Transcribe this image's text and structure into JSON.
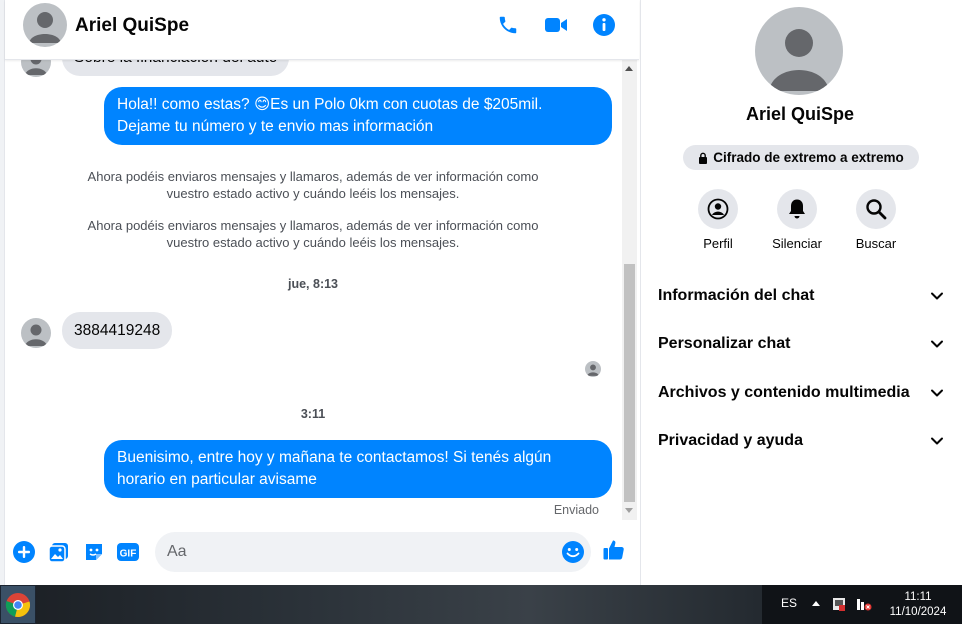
{
  "contact": {
    "name": "Ariel QuiSpe"
  },
  "header": {
    "icons": [
      "phone-icon",
      "video-icon",
      "info-icon"
    ]
  },
  "messages": {
    "partial_top": "Sobre la financiación del auto",
    "outgoing_1_line1": "Hola!! como estas? 😊Es un Polo 0km con cuotas de $205mil.",
    "outgoing_1_line2": "Dejame tu número y te envio mas información",
    "system_1_line1": "Ahora podéis enviaros mensajes y llamaros, además de ver información como",
    "system_1_line2": "vuestro estado activo y cuándo leéis los mensajes.",
    "system_2_line1": "Ahora podéis enviaros mensajes y llamaros, además de ver información como",
    "system_2_line2": "vuestro estado activo y cuándo leéis los mensajes.",
    "time_1": "jue, 8:13",
    "incoming_phone": "3884419248",
    "time_2": "3:11",
    "outgoing_2_line1": "Buenisimo, entre hoy y mañana te contactamos! Si tenés algún",
    "outgoing_2_line2": "horario en particular avisame",
    "status": "Enviado"
  },
  "composer": {
    "placeholder": "Aa"
  },
  "panel": {
    "encryption": "Cifrado de extremo a extremo",
    "actions": [
      {
        "label": "Perfil",
        "icon": "profile-icon"
      },
      {
        "label": "Silenciar",
        "icon": "bell-icon"
      },
      {
        "label": "Buscar",
        "icon": "search-icon"
      }
    ],
    "sections": [
      "Información del chat",
      "Personalizar chat",
      "Archivos y contenido multimedia",
      "Privacidad y ayuda"
    ]
  },
  "taskbar": {
    "language": "ES",
    "time": "11:11",
    "date": "11/10/2024"
  },
  "colors": {
    "accent": "#0084ff",
    "bubble_in": "#e4e6eb",
    "text": "#050505"
  }
}
